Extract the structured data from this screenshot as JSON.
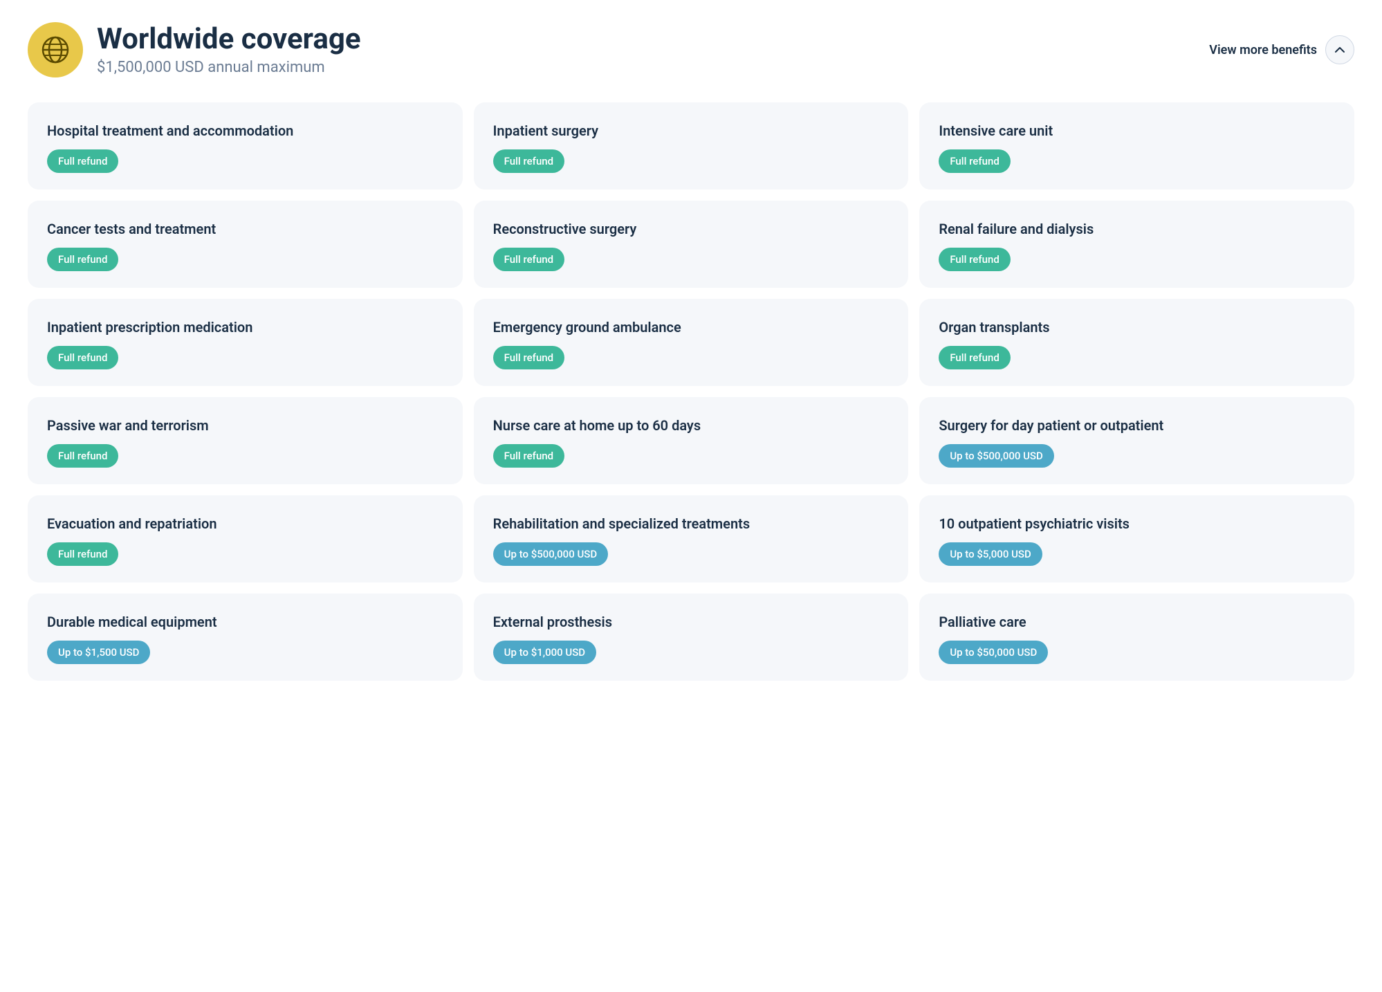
{
  "header": {
    "title": "Worldwide coverage",
    "subtitle": "$1,500,000 USD annual maximum",
    "view_more_label": "View more benefits",
    "globe_icon": "globe-icon"
  },
  "benefits": [
    {
      "id": "hospital-treatment",
      "title": "Hospital treatment and accommodation",
      "badge_text": "Full refund",
      "badge_type": "green"
    },
    {
      "id": "inpatient-surgery",
      "title": "Inpatient surgery",
      "badge_text": "Full refund",
      "badge_type": "green"
    },
    {
      "id": "intensive-care",
      "title": "Intensive care unit",
      "badge_text": "Full refund",
      "badge_type": "green"
    },
    {
      "id": "cancer-tests",
      "title": "Cancer tests and treatment",
      "badge_text": "Full refund",
      "badge_type": "green"
    },
    {
      "id": "reconstructive-surgery",
      "title": "Reconstructive surgery",
      "badge_text": "Full refund",
      "badge_type": "green"
    },
    {
      "id": "renal-failure",
      "title": "Renal failure and dialysis",
      "badge_text": "Full refund",
      "badge_type": "green"
    },
    {
      "id": "inpatient-prescription",
      "title": "Inpatient prescription medication",
      "badge_text": "Full refund",
      "badge_type": "green"
    },
    {
      "id": "emergency-ambulance",
      "title": "Emergency ground ambulance",
      "badge_text": "Full refund",
      "badge_type": "green"
    },
    {
      "id": "organ-transplants",
      "title": "Organ transplants",
      "badge_text": "Full refund",
      "badge_type": "green"
    },
    {
      "id": "passive-war",
      "title": "Passive war and terrorism",
      "badge_text": "Full refund",
      "badge_type": "green"
    },
    {
      "id": "nurse-care",
      "title": "Nurse care at home up to 60 days",
      "badge_text": "Full refund",
      "badge_type": "green"
    },
    {
      "id": "surgery-day-patient",
      "title": "Surgery for day patient or outpatient",
      "badge_text": "Up to $500,000 USD",
      "badge_type": "blue"
    },
    {
      "id": "evacuation-repatriation",
      "title": "Evacuation and repatriation",
      "badge_text": "Full refund",
      "badge_type": "green"
    },
    {
      "id": "rehabilitation",
      "title": "Rehabilitation and specialized treatments",
      "badge_text": "Up to $500,000 USD",
      "badge_type": "blue"
    },
    {
      "id": "outpatient-psychiatric",
      "title": "10 outpatient psychiatric visits",
      "badge_text": "Up to $5,000 USD",
      "badge_type": "blue"
    },
    {
      "id": "durable-medical",
      "title": "Durable medical equipment",
      "badge_text": "Up to $1,500 USD",
      "badge_type": "blue"
    },
    {
      "id": "external-prosthesis",
      "title": "External prosthesis",
      "badge_text": "Up to $1,000 USD",
      "badge_type": "blue"
    },
    {
      "id": "palliative-care",
      "title": "Palliative care",
      "badge_text": "Up to $50,000 USD",
      "badge_type": "blue"
    }
  ]
}
